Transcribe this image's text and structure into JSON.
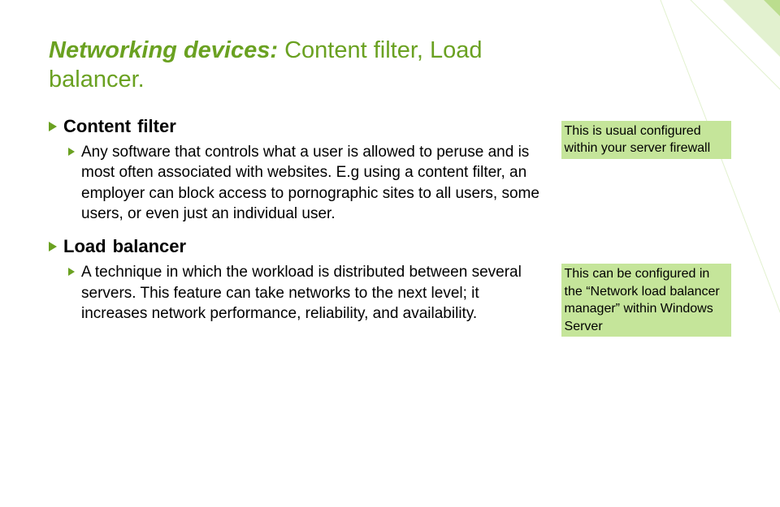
{
  "title": {
    "em": "Networking devices:",
    "rest": " Content filter, Load balancer."
  },
  "sections": [
    {
      "heading_lead": "Content",
      "heading_tail": "filter",
      "body_lead": "Any",
      "body_rest": " software that controls what a user is allowed to peruse and is most often associated with websites. E.g using a content filter, an employer can block access to pornographic sites to all users, some users, or even just an individual user.",
      "note": "This is usual configured within your server firewall"
    },
    {
      "heading_lead": "Load",
      "heading_tail": "balancer",
      "body_lead": "A",
      "body_rest": " technique in which the workload is distributed between several servers. This feature can take networks to the next level; it increases network performance, reliability, and availability.",
      "note": "This can be configured in the “Network load balancer manager” within Windows Server"
    }
  ]
}
